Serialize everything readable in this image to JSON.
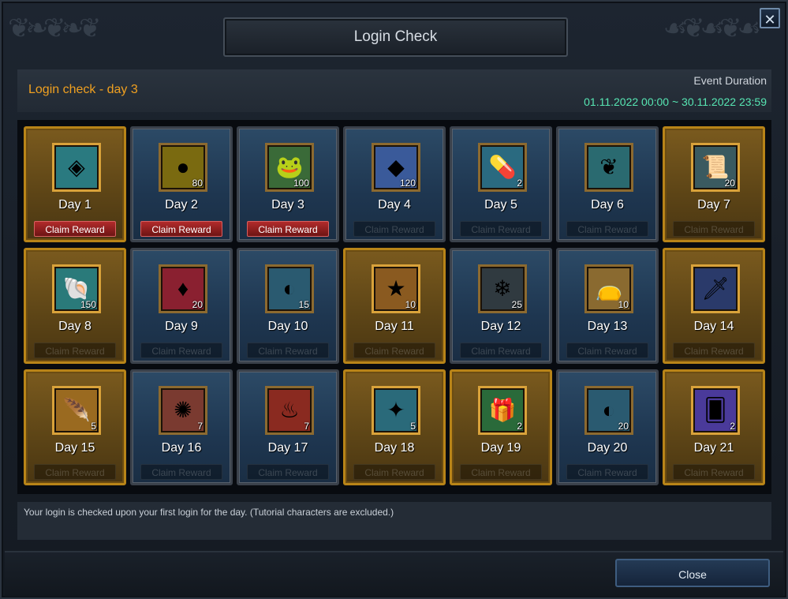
{
  "window": {
    "title": "Login Check",
    "close_glyph": "✕"
  },
  "header": {
    "login_day": "Login check - day 3",
    "duration_label": "Event Duration",
    "duration_value": "01.11.2022 00:00 ~ 30.11.2022 23:59"
  },
  "colors": {
    "login_day": "#f0a020",
    "duration": "#57e6b3",
    "claim_active": "#b22b2b",
    "gold_cell": "#b88418"
  },
  "days": [
    {
      "label": "Day 1",
      "quantity": "",
      "icon": "cape-icon",
      "glyph": "◈",
      "bg": "#2a7a80",
      "style": "gold",
      "claim": "Claim Reward",
      "claimable": true
    },
    {
      "label": "Day 2",
      "quantity": "80",
      "icon": "orb-icon",
      "glyph": "●",
      "bg": "#7a6a10",
      "style": "blue",
      "claim": "Claim Reward",
      "claimable": true
    },
    {
      "label": "Day 3",
      "quantity": "100",
      "icon": "frog-icon",
      "glyph": "🐸",
      "bg": "#3a6a38",
      "style": "blue",
      "claim": "Claim Reward",
      "claimable": true
    },
    {
      "label": "Day 4",
      "quantity": "120",
      "icon": "crystal-icon",
      "glyph": "◆",
      "bg": "#3a5a9a",
      "style": "blue",
      "claim": "Claim Reward",
      "claimable": false
    },
    {
      "label": "Day 5",
      "quantity": "2",
      "icon": "pill-icon",
      "glyph": "💊",
      "bg": "#2a6a80",
      "style": "blue",
      "claim": "Claim Reward",
      "claimable": false
    },
    {
      "label": "Day 6",
      "quantity": "",
      "icon": "rose-icon",
      "glyph": "❦",
      "bg": "#2a6a70",
      "style": "blue",
      "claim": "Claim Reward",
      "claimable": false
    },
    {
      "label": "Day 7",
      "quantity": "20",
      "icon": "scroll-icon",
      "glyph": "📜",
      "bg": "#3a5a60",
      "style": "gold",
      "claim": "Claim Reward",
      "claimable": false
    },
    {
      "label": "Day 8",
      "quantity": "150",
      "icon": "shell-icon",
      "glyph": "🐚",
      "bg": "#2a7a7a",
      "style": "gold",
      "claim": "Claim Reward",
      "claimable": false
    },
    {
      "label": "Day 9",
      "quantity": "20",
      "icon": "red-crystal-icon",
      "glyph": "♦",
      "bg": "#8a2030",
      "style": "blue",
      "claim": "Claim Reward",
      "claimable": false
    },
    {
      "label": "Day 10",
      "quantity": "15",
      "icon": "stone-icon",
      "glyph": "◐",
      "bg": "#2a5a70",
      "style": "blue",
      "claim": "Claim Reward",
      "claimable": false
    },
    {
      "label": "Day 11",
      "quantity": "10",
      "icon": "star-icon",
      "glyph": "★",
      "bg": "#8a5a20",
      "style": "gold",
      "claim": "Claim Reward",
      "claimable": false
    },
    {
      "label": "Day 12",
      "quantity": "25",
      "icon": "ice-crystal-icon",
      "glyph": "❄",
      "bg": "#303a40",
      "style": "blue",
      "claim": "Claim Reward",
      "claimable": false
    },
    {
      "label": "Day 13",
      "quantity": "10",
      "icon": "pouch-icon",
      "glyph": "👝",
      "bg": "#8a6a30",
      "style": "blue",
      "claim": "Claim Reward",
      "claimable": false
    },
    {
      "label": "Day 14",
      "quantity": "",
      "icon": "dagger-icon",
      "glyph": "🗡",
      "bg": "#2a3a6a",
      "style": "gold",
      "claim": "Claim Reward",
      "claimable": false
    },
    {
      "label": "Day 15",
      "quantity": "5",
      "icon": "feather-icon",
      "glyph": "🪶",
      "bg": "#9a6a20",
      "style": "gold",
      "claim": "Claim Reward",
      "claimable": false
    },
    {
      "label": "Day 16",
      "quantity": "7",
      "icon": "rune-stone-icon",
      "glyph": "✺",
      "bg": "#7a3a30",
      "style": "blue",
      "claim": "Claim Reward",
      "claimable": false
    },
    {
      "label": "Day 17",
      "quantity": "7",
      "icon": "fire-rune-icon",
      "glyph": "♨",
      "bg": "#8a2a20",
      "style": "blue",
      "claim": "Claim Reward",
      "claimable": false
    },
    {
      "label": "Day 18",
      "quantity": "5",
      "icon": "amulet-icon",
      "glyph": "✦",
      "bg": "#2a6a7a",
      "style": "gold",
      "claim": "Claim Reward",
      "claimable": false
    },
    {
      "label": "Day 19",
      "quantity": "2",
      "icon": "gift-box-icon",
      "glyph": "🎁",
      "bg": "#2a6a3a",
      "style": "gold",
      "claim": "Claim Reward",
      "claimable": false
    },
    {
      "label": "Day 20",
      "quantity": "20",
      "icon": "stone-icon",
      "glyph": "◐",
      "bg": "#2a5a70",
      "style": "blue",
      "claim": "Claim Reward",
      "claimable": false
    },
    {
      "label": "Day 21",
      "quantity": "2",
      "icon": "card-icon",
      "glyph": "🂠",
      "bg": "#4a3a9a",
      "style": "gold",
      "claim": "Claim Reward",
      "claimable": false
    }
  ],
  "note": "Your login is checked upon your first login for the day. (Tutorial characters are excluded.)",
  "footer": {
    "close_label": "Close"
  }
}
